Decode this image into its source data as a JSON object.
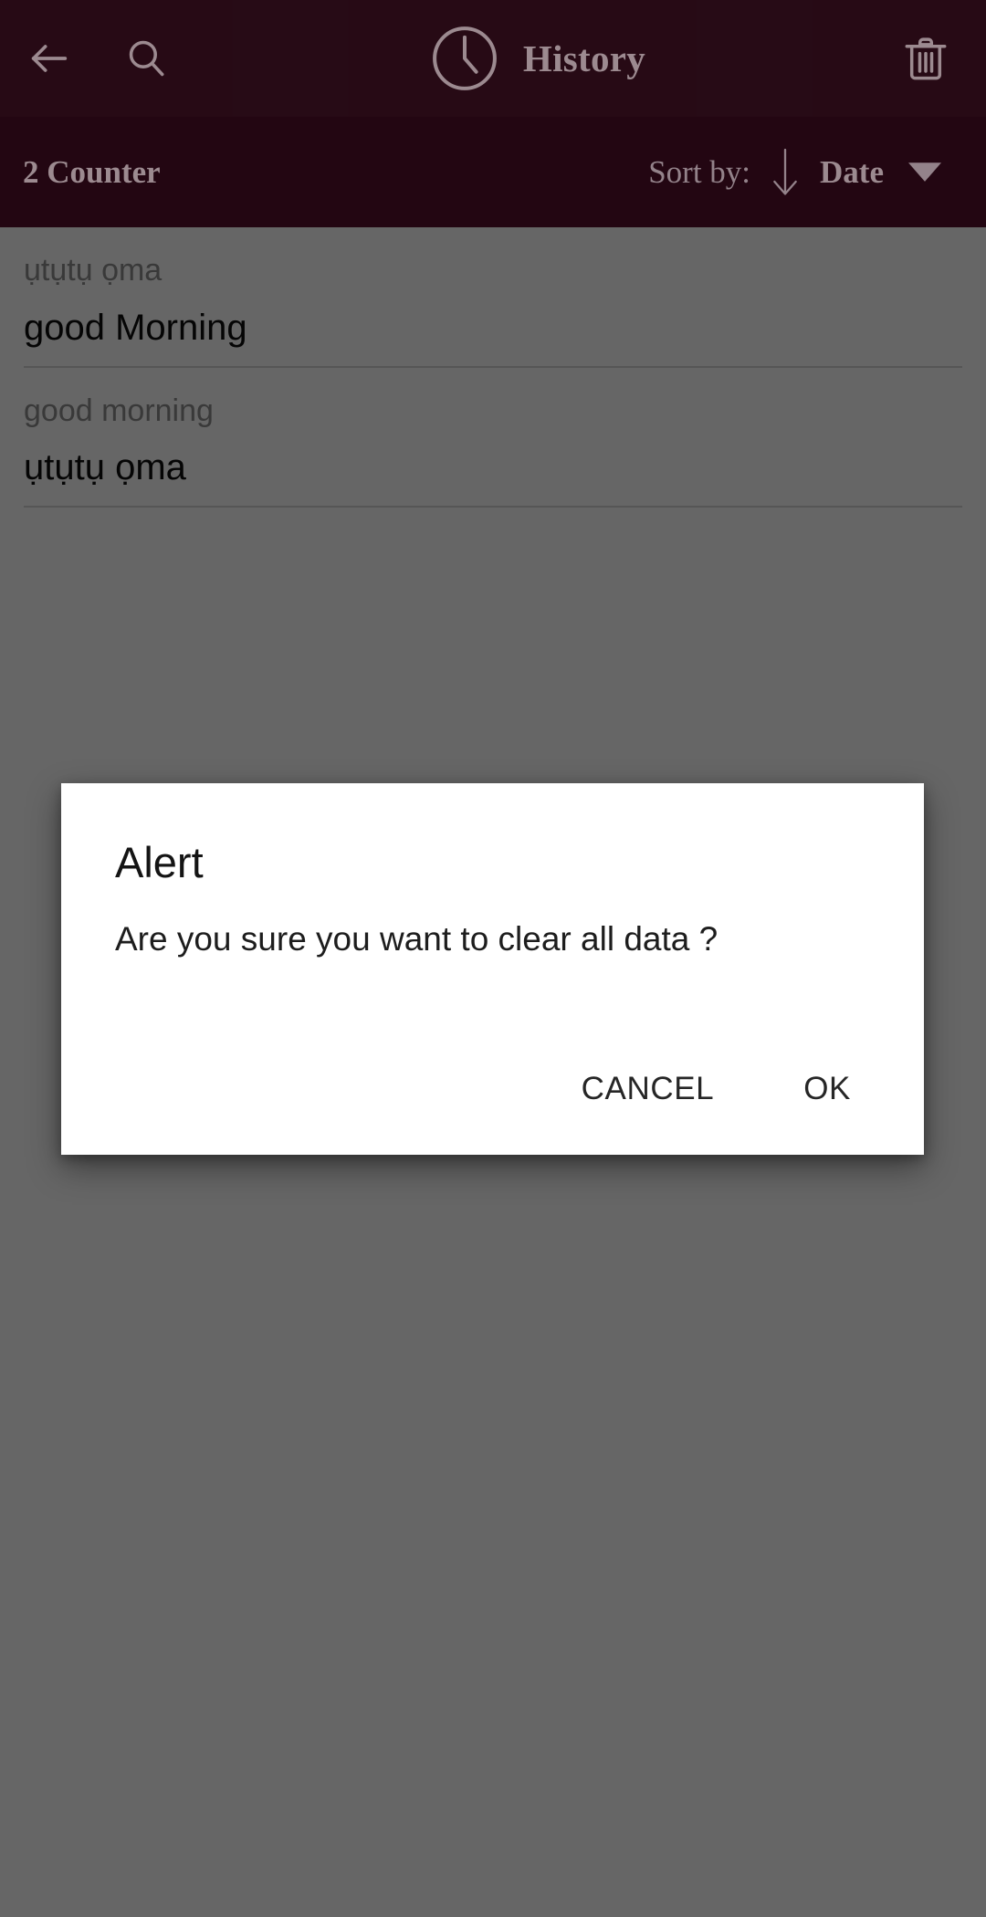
{
  "appbar": {
    "back_icon": "arrow-left-icon",
    "search_icon": "search-icon",
    "clock_icon": "clock-icon",
    "title": "History",
    "delete_icon": "trash-icon",
    "background_color": "#3a1020",
    "text_color": "#9c8a90"
  },
  "subbar": {
    "counter_label": "2 Counter",
    "sort_by_label": "Sort by:",
    "sort_direction_icon": "arrow-down-icon",
    "sort_value": "Date",
    "dropdown_icon": "caret-down-icon",
    "background_color": "#330a1a"
  },
  "list": {
    "items": [
      {
        "subtitle": "ụtụtụ ọma",
        "title": "good Morning"
      },
      {
        "subtitle": "good morning",
        "title": "ụtụtụ ọma"
      }
    ]
  },
  "dialog": {
    "title": "Alert",
    "message": "Are you sure you want to clear all data ?",
    "cancel_label": "CANCEL",
    "ok_label": "OK",
    "background_color": "#ffffff"
  },
  "scrim": {
    "color": "rgba(0,0,0,0.60)"
  }
}
